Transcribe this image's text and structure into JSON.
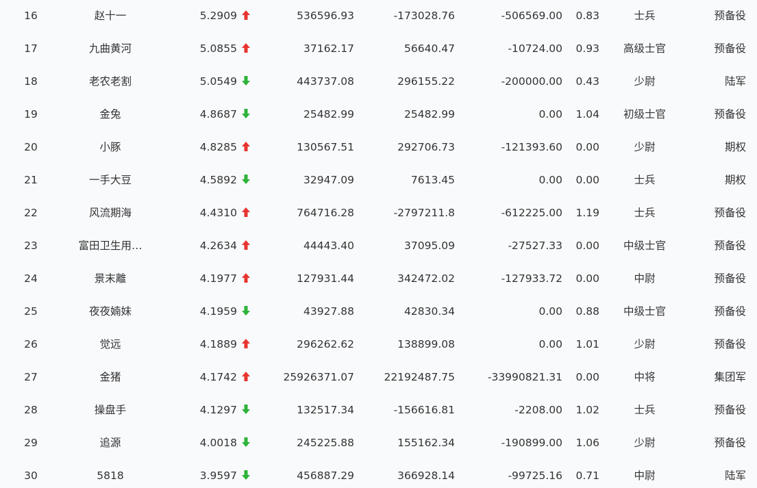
{
  "colors": {
    "up": "#e8352f",
    "down": "#2db33a",
    "text": "#333333",
    "background": "#f9fafc"
  },
  "rows": [
    {
      "rank": "16",
      "name": "赵十一",
      "score": "5.2909",
      "trend": "up",
      "v1": "536596.93",
      "v2": "-173028.76",
      "v3": "-506569.00",
      "ratio": "0.83",
      "level": "士兵",
      "group": "预备役"
    },
    {
      "rank": "17",
      "name": "九曲黄河",
      "score": "5.0855",
      "trend": "up",
      "v1": "37162.17",
      "v2": "56640.47",
      "v3": "-10724.00",
      "ratio": "0.93",
      "level": "高级士官",
      "group": "预备役"
    },
    {
      "rank": "18",
      "name": "老农老割",
      "score": "5.0549",
      "trend": "down",
      "v1": "443737.08",
      "v2": "296155.22",
      "v3": "-200000.00",
      "ratio": "0.43",
      "level": "少尉",
      "group": "陆军"
    },
    {
      "rank": "19",
      "name": "金兔",
      "score": "4.8687",
      "trend": "down",
      "v1": "25482.99",
      "v2": "25482.99",
      "v3": "0.00",
      "ratio": "1.04",
      "level": "初级士官",
      "group": "预备役"
    },
    {
      "rank": "20",
      "name": "小豚",
      "score": "4.8285",
      "trend": "up",
      "v1": "130567.51",
      "v2": "292706.73",
      "v3": "-121393.60",
      "ratio": "0.00",
      "level": "少尉",
      "group": "期权"
    },
    {
      "rank": "21",
      "name": "一手大豆",
      "score": "4.5892",
      "trend": "down",
      "v1": "32947.09",
      "v2": "7613.45",
      "v3": "0.00",
      "ratio": "0.00",
      "level": "士兵",
      "group": "期权"
    },
    {
      "rank": "22",
      "name": "风流期海",
      "score": "4.4310",
      "trend": "up",
      "v1": "764716.28",
      "v2": "-2797211.8",
      "v3": "-612225.00",
      "ratio": "1.19",
      "level": "士兵",
      "group": "预备役"
    },
    {
      "rank": "23",
      "name": "富田卫生用…",
      "score": "4.2634",
      "trend": "up",
      "v1": "44443.40",
      "v2": "37095.09",
      "v3": "-27527.33",
      "ratio": "0.00",
      "level": "中级士官",
      "group": "预备役"
    },
    {
      "rank": "24",
      "name": "景末離",
      "score": "4.1977",
      "trend": "up",
      "v1": "127931.44",
      "v2": "342472.02",
      "v3": "-127933.72",
      "ratio": "0.00",
      "level": "中尉",
      "group": "预备役"
    },
    {
      "rank": "25",
      "name": "夜夜婻妹",
      "score": "4.1959",
      "trend": "down",
      "v1": "43927.88",
      "v2": "42830.34",
      "v3": "0.00",
      "ratio": "0.88",
      "level": "中级士官",
      "group": "预备役"
    },
    {
      "rank": "26",
      "name": "觉远",
      "score": "4.1889",
      "trend": "up",
      "v1": "296262.62",
      "v2": "138899.08",
      "v3": "0.00",
      "ratio": "1.01",
      "level": "少尉",
      "group": "预备役"
    },
    {
      "rank": "27",
      "name": "金猪",
      "score": "4.1742",
      "trend": "up",
      "v1": "25926371.07",
      "v2": "22192487.75",
      "v3": "-33990821.31",
      "ratio": "0.00",
      "level": "中将",
      "group": "集团军"
    },
    {
      "rank": "28",
      "name": "操盘手",
      "score": "4.1297",
      "trend": "down",
      "v1": "132517.34",
      "v2": "-156616.81",
      "v3": "-2208.00",
      "ratio": "1.02",
      "level": "士兵",
      "group": "预备役"
    },
    {
      "rank": "29",
      "name": "追源",
      "score": "4.0018",
      "trend": "down",
      "v1": "245225.88",
      "v2": "155162.34",
      "v3": "-190899.00",
      "ratio": "1.06",
      "level": "少尉",
      "group": "预备役"
    },
    {
      "rank": "30",
      "name": "5818",
      "score": "3.9597",
      "trend": "down",
      "v1": "456887.29",
      "v2": "366928.14",
      "v3": "-99725.16",
      "ratio": "0.71",
      "level": "中尉",
      "group": "陆军"
    }
  ]
}
